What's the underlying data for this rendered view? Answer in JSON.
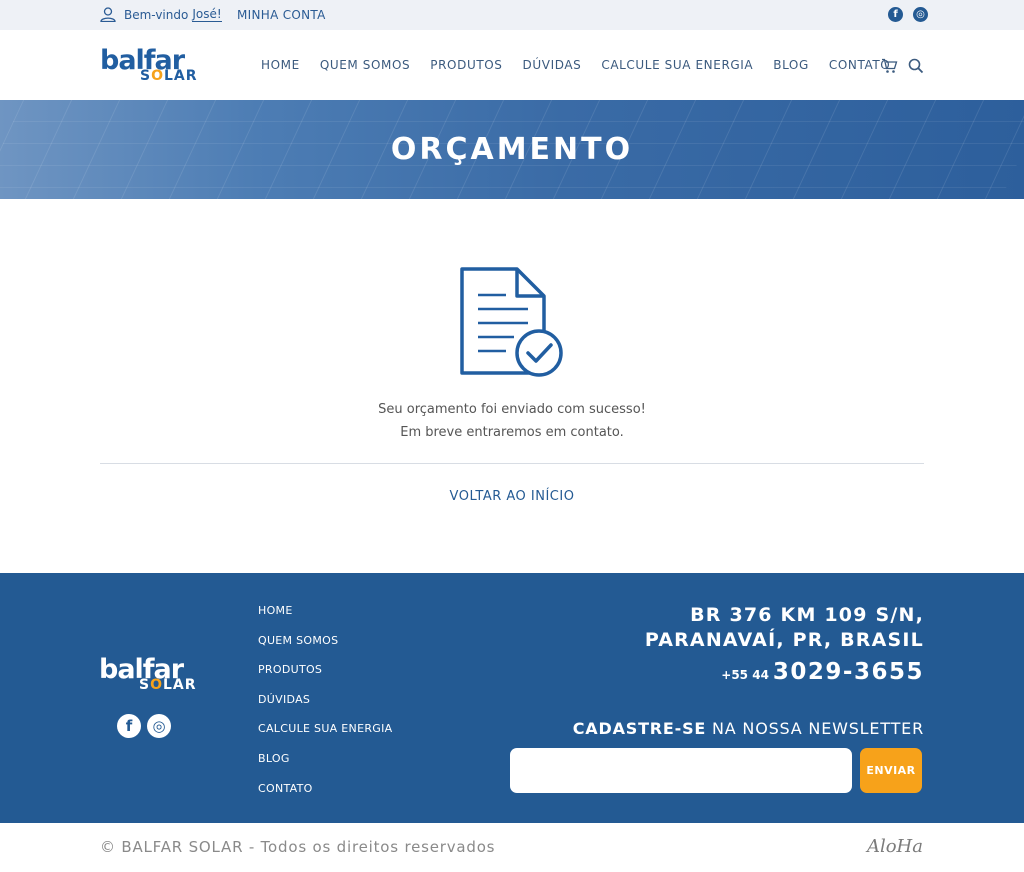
{
  "topbar": {
    "welcome_prefix": "Bem-vindo",
    "welcome_name": "José!",
    "account": "MINHA CONTA",
    "social": [
      "facebook-icon",
      "instagram-icon"
    ]
  },
  "header": {
    "logo_main": "balfar",
    "logo_sub_a": "S",
    "logo_sub_o": "O",
    "logo_sub_b": "LAR",
    "nav": [
      "HOME",
      "QUEM SOMOS",
      "PRODUTOS",
      "DÚVIDAS",
      "CALCULE SUA ENERGIA",
      "BLOG",
      "CONTATO"
    ]
  },
  "banner": {
    "title": "ORÇAMENTO"
  },
  "main": {
    "line1": "Seu orçamento foi enviado com sucesso!",
    "line2": "Em breve entraremos em contato.",
    "back": "VOLTAR AO INÍCIO"
  },
  "footer": {
    "logo_main": "balfar",
    "logo_sub_a": "S",
    "logo_sub_o": "O",
    "logo_sub_b": "LAR",
    "nav": [
      "HOME",
      "QUEM SOMOS",
      "PRODUTOS",
      "DÚVIDAS",
      "CALCULE SUA ENERGIA",
      "BLOG",
      "CONTATO"
    ],
    "address_line1": "BR 376 KM 109 S/N,",
    "address_line2": "PARANAVAÍ, PR,  BRASIL",
    "phone_prefix": "+55 44",
    "phone_number": "3029-3655",
    "newsletter_bold": "CADASTRE-SE",
    "newsletter_rest": " NA NOSSA NEWSLETTER",
    "send": "ENVIAR"
  },
  "bottom": {
    "copyright": "© BALFAR SOLAR - Todos os direitos reservados",
    "agency": "AloHa"
  },
  "colors": {
    "primary": "#235a93",
    "accent": "#f7a21a"
  }
}
